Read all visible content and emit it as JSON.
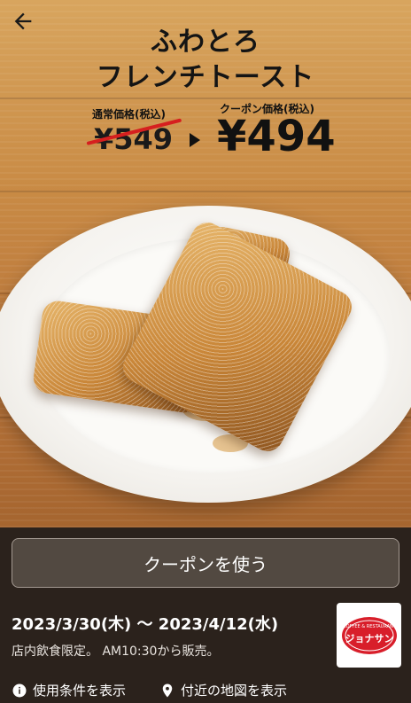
{
  "header": {
    "title_line1": "ふわとろ",
    "title_line2": "フレンチトースト"
  },
  "pricing": {
    "regular_label": "通常価格(税込)",
    "regular_price": "¥549",
    "coupon_label": "クーポン価格(税込)",
    "coupon_price": "¥494"
  },
  "action": {
    "use_coupon_label": "クーポンを使う"
  },
  "details": {
    "date_range": "2023/3/30(木) 〜 2023/4/12(水)",
    "note": "店内飲食限定。 AM10:30から販売。"
  },
  "links": {
    "terms_label": "使用条件を表示",
    "map_label": "付近の地図を表示"
  },
  "logo": {
    "small_text": "COFFEE & RESTAURANT",
    "brand_text": "ジョナサン"
  },
  "colors": {
    "accent_strike": "#d61f1f",
    "panel_bg": "#2b221c",
    "button_bg": "#524941",
    "logo_red": "#d81e2a"
  },
  "icons": {
    "back": "arrow-left",
    "info": "info-circle",
    "map": "map-pin"
  }
}
